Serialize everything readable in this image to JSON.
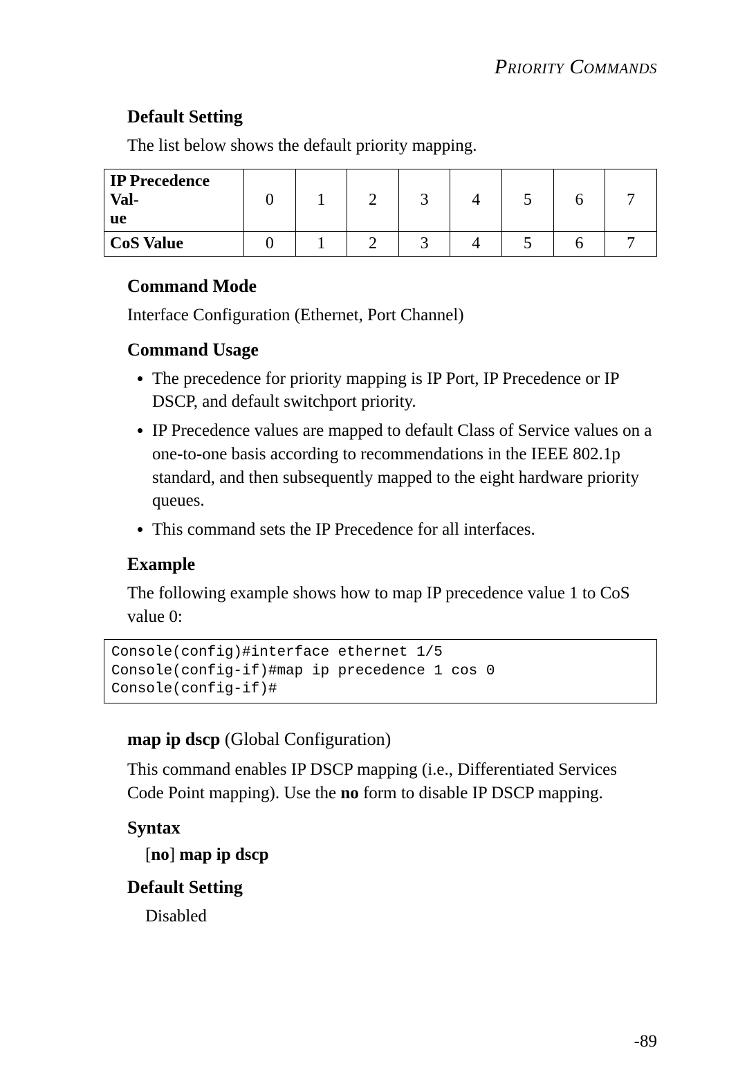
{
  "running_head": "Priority Commands",
  "headings": {
    "default_setting_1": "Default Setting",
    "command_mode": "Command Mode",
    "command_usage": "Command Usage",
    "example": "Example",
    "syntax": "Syntax",
    "default_setting_2": "Default Setting"
  },
  "default_setting_intro": "The list below shows the default priority mapping.",
  "chart_data": {
    "type": "table",
    "title": "Default priority mapping",
    "rows": [
      {
        "label": "IP Precedence Value",
        "values": [
          "0",
          "1",
          "2",
          "3",
          "4",
          "5",
          "6",
          "7"
        ]
      },
      {
        "label": "CoS Value",
        "values": [
          "0",
          "1",
          "2",
          "3",
          "4",
          "5",
          "6",
          "7"
        ]
      }
    ]
  },
  "table_row0_label_line1": "IP Precedence Val-",
  "table_row0_label_line2": "ue",
  "table_row1_label": "CoS Value",
  "table_cols": [
    "0",
    "1",
    "2",
    "3",
    "4",
    "5",
    "6",
    "7"
  ],
  "command_mode_text": "Interface Configuration (Ethernet, Port Channel)",
  "usage_bullets": [
    "The precedence for priority mapping is IP Port, IP Precedence or IP DSCP, and default switchport priority.",
    "IP Precedence values are mapped to default Class of Service values on a one-to-one basis according to recommendations in the IEEE 802.1p standard, and then subsequently mapped to the eight hardware priority queues.",
    "This command sets the IP Precedence for all interfaces."
  ],
  "example_intro": "The following example shows how to map IP precedence value 1 to CoS value 0:",
  "console_block": "Console(config)#interface ethernet 1/5\nConsole(config-if)#map ip precedence 1 cos 0\nConsole(config-if)#",
  "cmd2": {
    "name": "map ip dscp",
    "context": " (Global Configuration)",
    "desc_pre": "This command enables IP DSCP mapping (i.e., Differentiated Services Code Point mapping). Use the ",
    "desc_bold": "no",
    "desc_post": " form to disable IP DSCP mapping.",
    "syntax_prefix": "[",
    "syntax_no": "no",
    "syntax_mid": "] ",
    "syntax_cmd": "map ip dscp",
    "default_setting_value": "Disabled"
  },
  "page_number": "-89"
}
